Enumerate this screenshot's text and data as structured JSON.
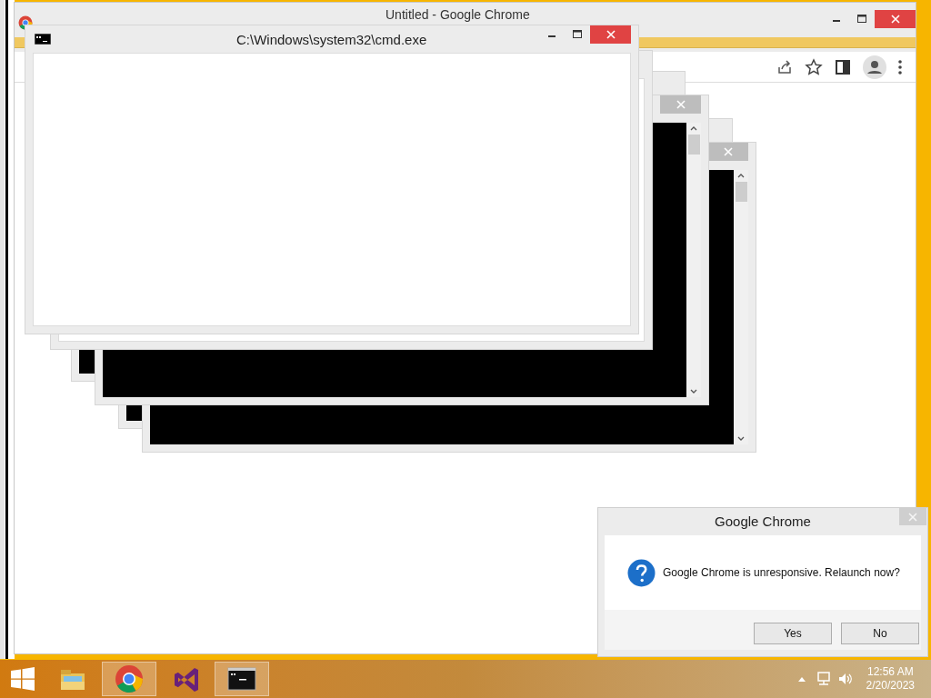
{
  "chrome_window": {
    "title": "Untitled - Google Chrome"
  },
  "console_windows": [
    {
      "kind": "console",
      "close_visible": false
    },
    {
      "kind": "console",
      "close_visible": false
    },
    {
      "kind": "console",
      "close_visible": true
    },
    {
      "kind": "console",
      "close_visible": true
    },
    {
      "kind": "blank",
      "close_visible": false
    },
    {
      "kind": "blank",
      "close_visible": true,
      "title": "C:\\Windows\\system32\\cmd.exe",
      "active": true
    }
  ],
  "dialog": {
    "title": "Google Chrome",
    "message": "Google Chrome is unresponsive. Relaunch now?",
    "buttons": [
      "Yes",
      "No"
    ]
  },
  "taskbar": {
    "apps": [
      {
        "kind": "explorer",
        "running": false
      },
      {
        "kind": "chrome",
        "running": true
      },
      {
        "kind": "studio",
        "running": false
      },
      {
        "kind": "console",
        "running": true
      }
    ],
    "clock": {
      "time": "12:56 AM",
      "date": "2/20/2023"
    }
  }
}
